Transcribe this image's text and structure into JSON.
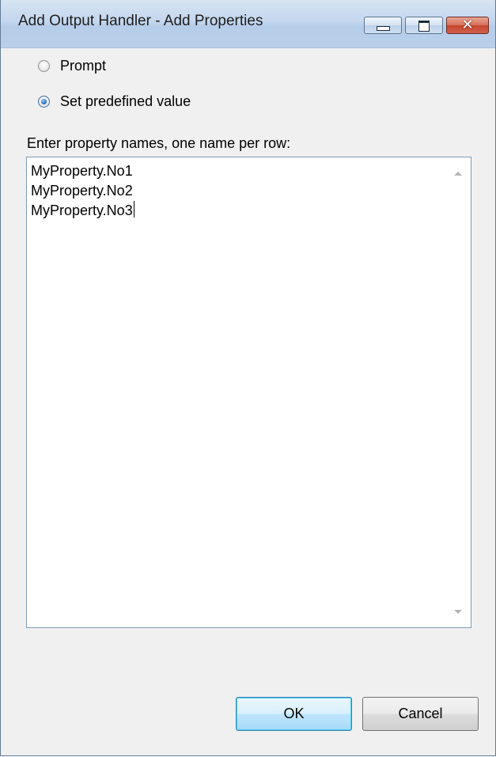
{
  "window": {
    "title": "Add Output Handler - Add Properties",
    "caption_buttons": {
      "minimize": "minimize-icon",
      "maximize": "maximize-icon",
      "close": "close-icon",
      "close_glyph": "✕"
    }
  },
  "options": {
    "prompt_label": "Prompt",
    "predefined_label": "Set predefined value",
    "selected": "Set predefined value"
  },
  "properties": {
    "label": "Enter property names, one name per row:",
    "lines": [
      "MyProperty.No1",
      "MyProperty.No2",
      "MyProperty.No3"
    ]
  },
  "buttons": {
    "ok_label": "OK",
    "cancel_label": "Cancel"
  },
  "colors": {
    "titlebar": "#c4d7ee",
    "close_button": "#c6452d",
    "default_button_border": "#3c7fb1",
    "textbox_border": "#7f9db9"
  }
}
